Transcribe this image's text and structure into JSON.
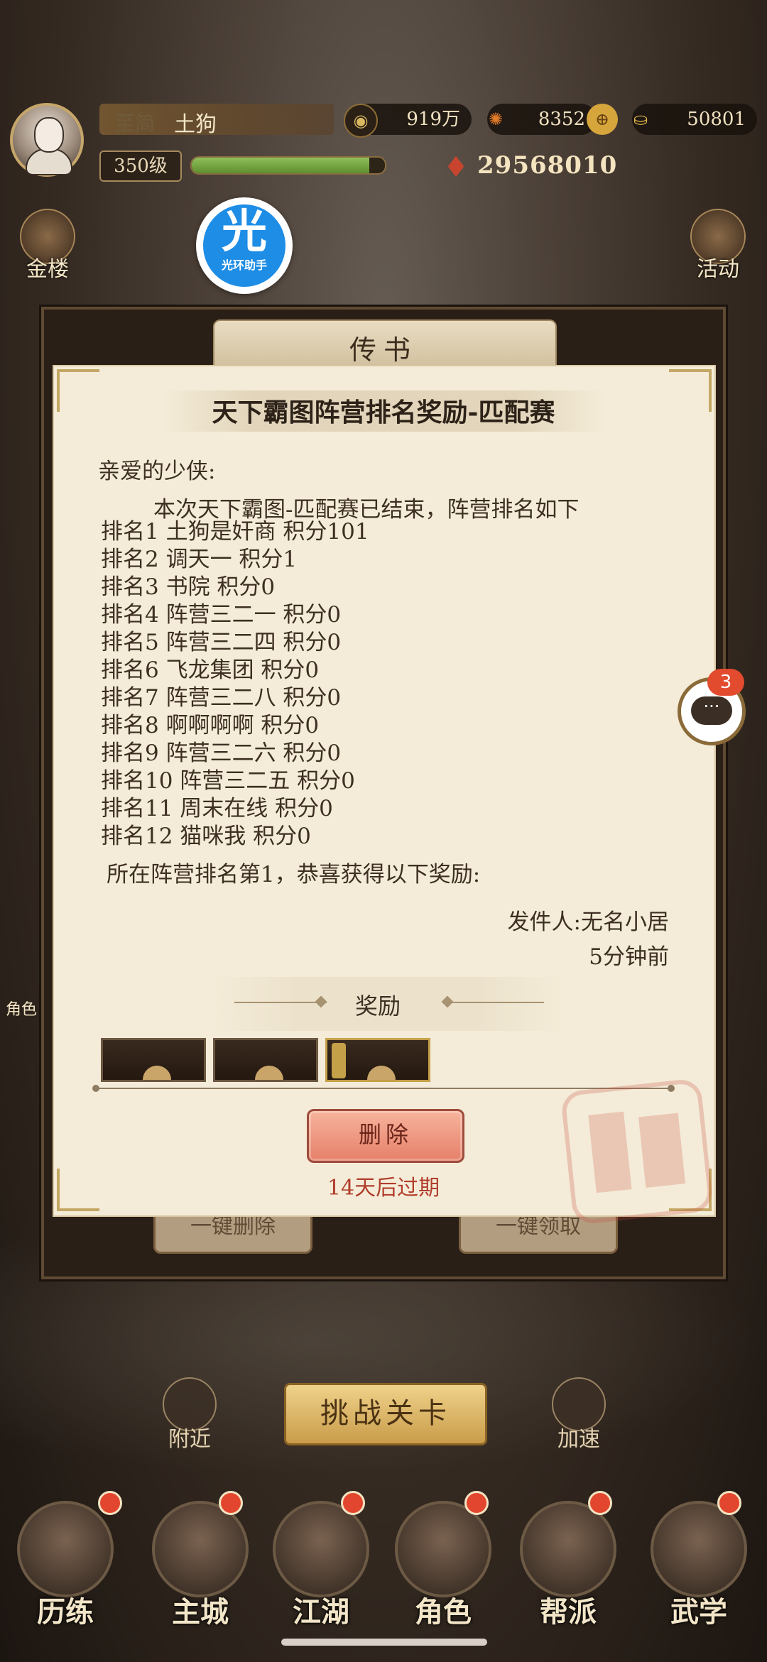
{
  "player": {
    "vip_label": "至简",
    "name": "土狗",
    "level": "350级",
    "exp_fraction": 0.92,
    "power": "29568010"
  },
  "resources": {
    "coins": "919万",
    "gems": "8352",
    "ingots": "50801"
  },
  "side_buttons": {
    "left_top": "金楼",
    "right_top": "活动",
    "left_small": "角色"
  },
  "overlay_badge": {
    "char": "光",
    "label": "光环助手"
  },
  "mail": {
    "window_title": "传书",
    "letter_title": "天下霸图阵营排名奖励-匹配赛",
    "greeting": "亲爱的少侠:",
    "intro": "本次天下霸图-匹配赛已结束，阵营排名如下",
    "rankings": [
      "排名1 土狗是奸商 积分101",
      "排名2 调天一 积分1",
      "排名3 书院 积分0",
      "排名4 阵营三二一 积分0",
      "排名5 阵营三二四 积分0",
      "排名6 飞龙集团 积分0",
      "排名7 阵营三二八 积分0",
      "排名8 啊啊啊啊 积分0",
      "排名9 阵营三二六 积分0",
      "排名10 阵营三二五 积分0",
      "排名11 周末在线 积分0",
      "排名12 猫咪我 积分0"
    ],
    "result": "所在阵营排名第1，恭喜获得以下奖励:",
    "sender": "发件人:无名小居",
    "time": "5分钟前",
    "reward_title": "奖励",
    "delete_label": "删除",
    "expire": "14天后过期",
    "bulk_delete_label": "一键删除",
    "bulk_claim_label": "一键领取"
  },
  "chat": {
    "badge": "3",
    "dots": "···"
  },
  "challenge_label": "挑战关卡",
  "round_buttons": {
    "nearby": "附近",
    "speed": "加速"
  },
  "nav": [
    {
      "label": "历练"
    },
    {
      "label": "主城"
    },
    {
      "label": "江湖"
    },
    {
      "label": "角色"
    },
    {
      "label": "帮派"
    },
    {
      "label": "武学"
    }
  ],
  "colors": {
    "accent_red": "#b13d2c",
    "parchment": "#f4ecd8",
    "gold": "#c4a048"
  }
}
